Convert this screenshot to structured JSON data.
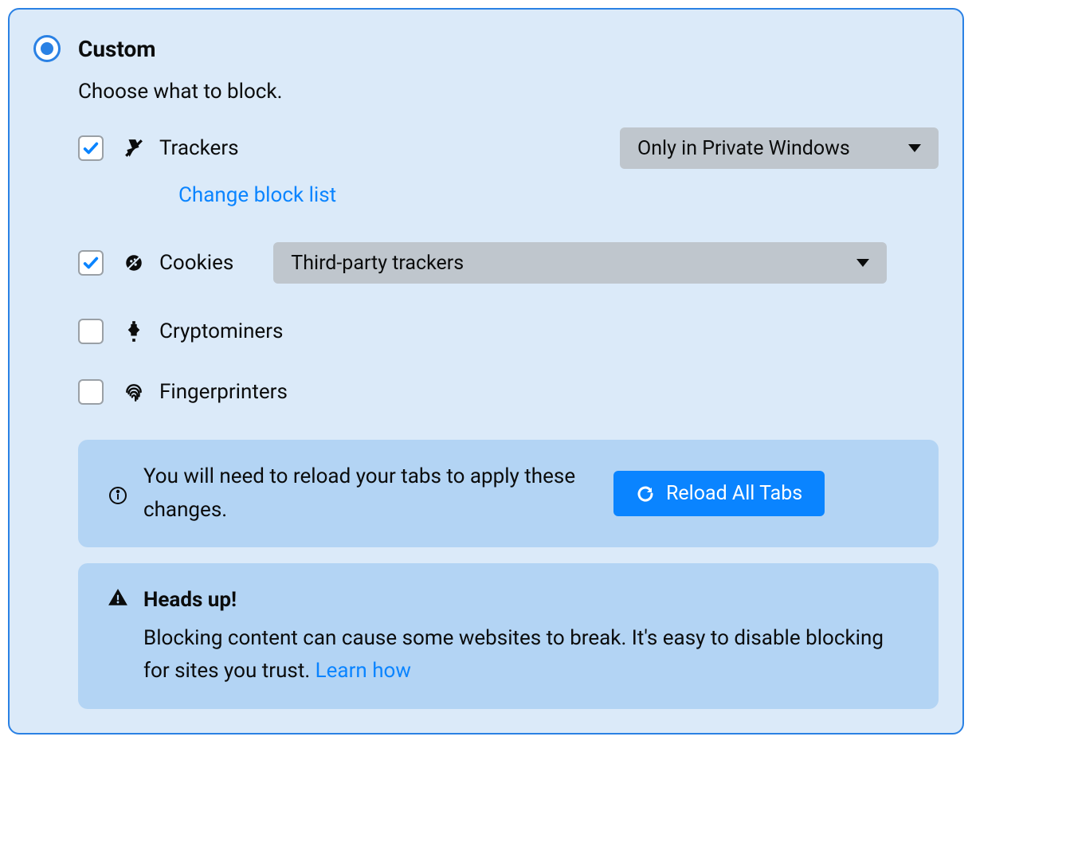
{
  "header": {
    "title": "Custom",
    "description": "Choose what to block."
  },
  "options": {
    "trackers": {
      "label": "Trackers",
      "checked": true,
      "select": "Only in Private Windows",
      "sublink": "Change block list"
    },
    "cookies": {
      "label": "Cookies",
      "checked": true,
      "select": "Third-party trackers"
    },
    "cryptominers": {
      "label": "Cryptominers",
      "checked": false
    },
    "fingerprinters": {
      "label": "Fingerprinters",
      "checked": false
    }
  },
  "reload_notice": {
    "text": "You will need to reload your tabs to apply these changes.",
    "button": "Reload All Tabs"
  },
  "warning_notice": {
    "heading": "Heads up!",
    "body_prefix": "Blocking content can cause some websites to break. It's easy to disable blocking for sites you trust.  ",
    "link": "Learn how"
  }
}
